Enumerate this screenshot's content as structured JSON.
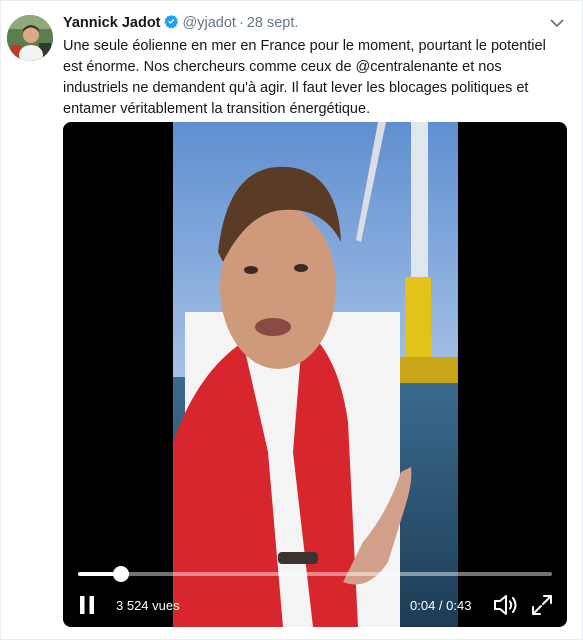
{
  "author": {
    "name": "Yannick Jadot",
    "handle": "@yjadot",
    "separator": "·",
    "date": "28 sept.",
    "verified": true
  },
  "tweet": {
    "text": "Une seule éolienne en mer en France pour le moment, pourtant le potentiel est énorme. Nos chercheurs comme ceux de @centralenante et nos industriels ne demandent qu'à agir. Il faut lever les blocages politiques et entamer véritablement la transition énergétique."
  },
  "video": {
    "views": "3 524 vues",
    "time": "0:04 / 0:43",
    "progress": 0.09,
    "state": "playing"
  },
  "icons": {
    "verified": "verified-badge-icon",
    "menu": "chevron-down-icon",
    "pause": "pause-icon",
    "volume": "volume-icon",
    "fullscreen": "fullscreen-icon"
  },
  "colors": {
    "accent": "#1da1f2",
    "secondary_text": "#657786",
    "text": "#14171a",
    "border": "#e6ecf0"
  }
}
